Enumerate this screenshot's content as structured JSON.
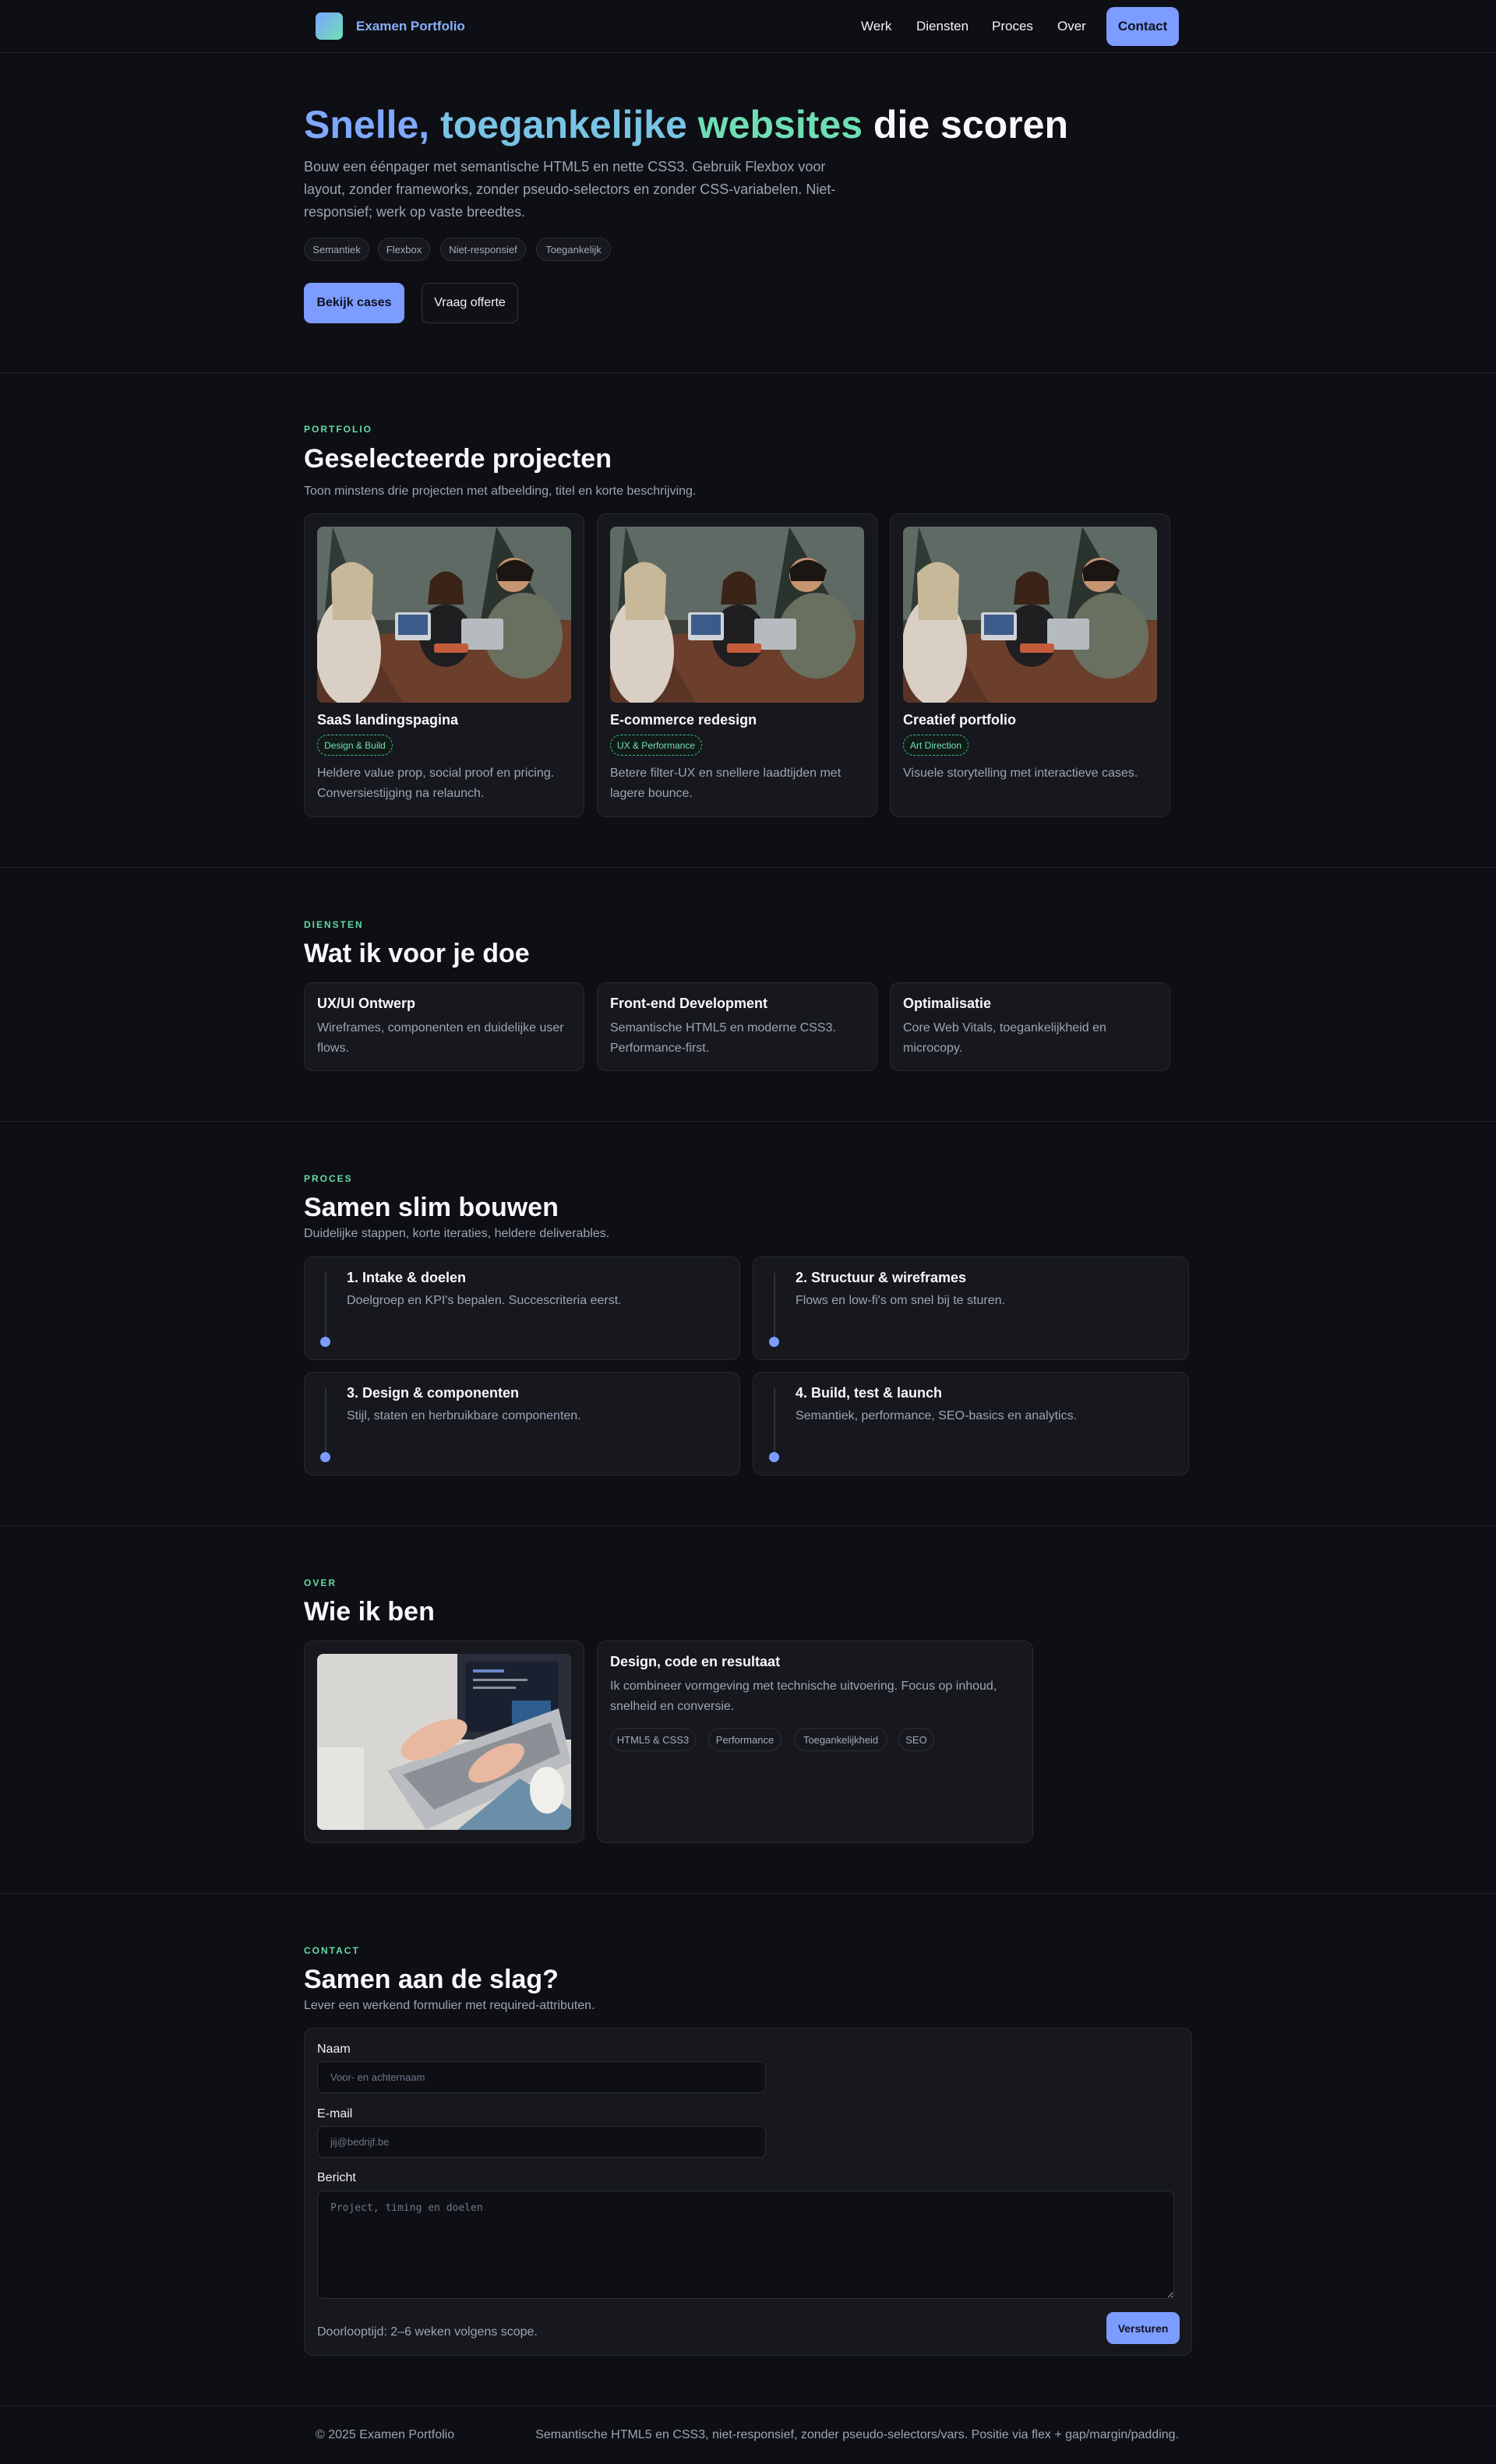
{
  "header": {
    "brand": "Examen Portfolio",
    "nav": [
      "Werk",
      "Diensten",
      "Proces",
      "Over"
    ],
    "contact_label": "Contact"
  },
  "hero": {
    "title_parts": [
      "Snelle,",
      "toegankelijke",
      "websites",
      "die scoren"
    ],
    "text": "Bouw een éénpager met semantische HTML5 en nette CSS3. Gebruik Flexbox voor layout, zonder frameworks, zonder pseudo-selectors en zonder CSS-variabelen. Niet-responsief; werk op vaste breedtes.",
    "pills": [
      "Semantiek",
      "Flexbox",
      "Niet-responsief",
      "Toegankelijk"
    ],
    "primary_cta": "Bekijk cases",
    "secondary_cta": "Vraag offerte"
  },
  "portfolio": {
    "eyebrow": "PORTFOLIO",
    "title": "Geselecteerde projecten",
    "subtitle": "Toon minstens drie projecten met afbeelding, titel en korte beschrijving.",
    "projects": [
      {
        "title": "SaaS landingspagina",
        "tag": "Design & Build",
        "text": "Heldere value prop, social proof en pricing. Conversiestijging na relaunch."
      },
      {
        "title": "E-commerce redesign",
        "tag": "UX & Performance",
        "text": "Betere filter-UX en snellere laadtijden met lagere bounce."
      },
      {
        "title": "Creatief portfolio",
        "tag": "Art Direction",
        "text": "Visuele storytelling met interactieve cases."
      }
    ]
  },
  "services": {
    "eyebrow": "DIENSTEN",
    "title": "Wat ik voor je doe",
    "items": [
      {
        "title": "UX/UI Ontwerp",
        "text": "Wireframes, componenten en duidelijke user flows."
      },
      {
        "title": "Front-end Development",
        "text": "Semantische HTML5 en moderne CSS3. Performance-first."
      },
      {
        "title": "Optimalisatie",
        "text": "Core Web Vitals, toegankelijkheid en microcopy."
      }
    ]
  },
  "process": {
    "eyebrow": "PROCES",
    "title": "Samen slim bouwen",
    "subtitle": "Duidelijke stappen, korte iteraties, heldere deliverables.",
    "steps": [
      {
        "title": "1. Intake & doelen",
        "text": "Doelgroep en KPI's bepalen. Succescriteria eerst."
      },
      {
        "title": "2. Structuur & wireframes",
        "text": "Flows en low-fi's om snel bij te sturen."
      },
      {
        "title": "3. Design & componenten",
        "text": "Stijl, staten en herbruikbare componenten."
      },
      {
        "title": "4. Build, test & launch",
        "text": "Semantiek, performance, SEO-basics en analytics."
      }
    ]
  },
  "about": {
    "eyebrow": "OVER",
    "title": "Wie ik ben",
    "card_title": "Design, code en resultaat",
    "card_text": "Ik combineer vormgeving met technische uitvoering. Focus op inhoud, snelheid en conversie.",
    "skills": [
      "HTML5 & CSS3",
      "Performance",
      "Toegankelijkheid",
      "SEO"
    ]
  },
  "contact": {
    "eyebrow": "CONTACT",
    "title": "Samen aan de slag?",
    "subtitle": "Lever een werkend formulier met required-attributen.",
    "name_label": "Naam",
    "name_placeholder": "Voor- en achternaam",
    "email_label": "E-mail",
    "email_placeholder": "jij@bedrijf.be",
    "message_label": "Bericht",
    "message_placeholder": "Project, timing en doelen",
    "note": "Doorlooptijd: 2–6 weken volgens scope.",
    "submit": "Versturen"
  },
  "footer": {
    "copyright": "© 2025 Examen Portfolio",
    "note": "Semantische HTML5 en CSS3, niet-responsief, zonder pseudo-selectors/vars. Positie via flex + gap/margin/padding."
  },
  "colors": {
    "background": "#0e0f14",
    "card": "#16181e",
    "accent_blue": "#7c9cff",
    "accent_green": "#62dba6",
    "muted_text": "#9ea4b4"
  }
}
